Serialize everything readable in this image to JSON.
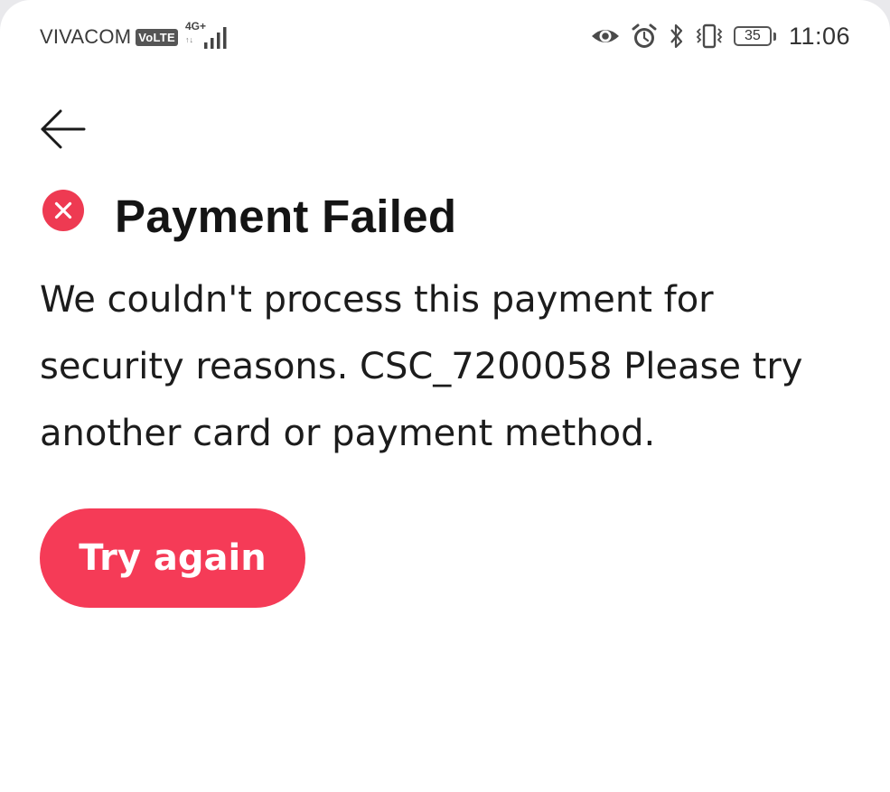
{
  "status_bar": {
    "carrier": "VIVACOM",
    "volte": "VoLTE",
    "network_type": "4G+",
    "network_activity": "↑↓",
    "battery_level": "35",
    "time": "11:06",
    "icons": [
      "eye-icon",
      "alarm-icon",
      "bluetooth-icon",
      "vibrate-icon",
      "battery-icon",
      "signal-icon"
    ]
  },
  "nav": {
    "back_icon": "arrow-left-icon"
  },
  "content": {
    "status_icon": "error-x-icon",
    "title": "Payment Failed",
    "message": "We couldn't process this payment for security reasons. CSC_7200058 Please try another card or payment method."
  },
  "actions": {
    "try_again_label": "Try again"
  },
  "colors": {
    "accent": "#f53b57",
    "error_icon": "#ee3a52",
    "text": "#141414",
    "background": "#ffffff"
  }
}
